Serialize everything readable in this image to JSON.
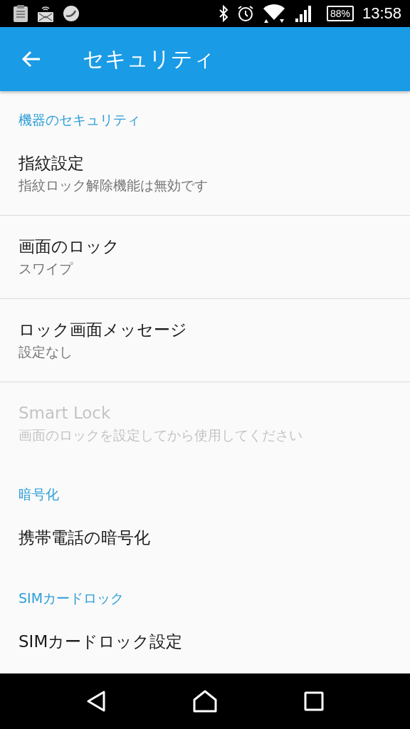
{
  "status_bar": {
    "battery": "88%",
    "time": "13:58"
  },
  "app_bar": {
    "title": "セキュリティ"
  },
  "sections": [
    {
      "title": "機器のセキュリティ",
      "items": [
        {
          "title": "指紋設定",
          "summary": "指紋ロック解除機能は無効です",
          "disabled": false,
          "divider": true
        },
        {
          "title": "画面のロック",
          "summary": "スワイプ",
          "disabled": false,
          "divider": true
        },
        {
          "title": "ロック画面メッセージ",
          "summary": "設定なし",
          "disabled": false,
          "divider": true
        },
        {
          "title": "Smart Lock",
          "summary": "画面のロックを設定してから使用してください",
          "disabled": true,
          "divider": false
        }
      ]
    },
    {
      "title": "暗号化",
      "items": [
        {
          "title": "携帯電話の暗号化",
          "disabled": false,
          "divider": false
        }
      ]
    },
    {
      "title": "SIMカードロック",
      "items": [
        {
          "title": "SIMカードロック設定",
          "disabled": false,
          "divider": false
        }
      ]
    }
  ]
}
